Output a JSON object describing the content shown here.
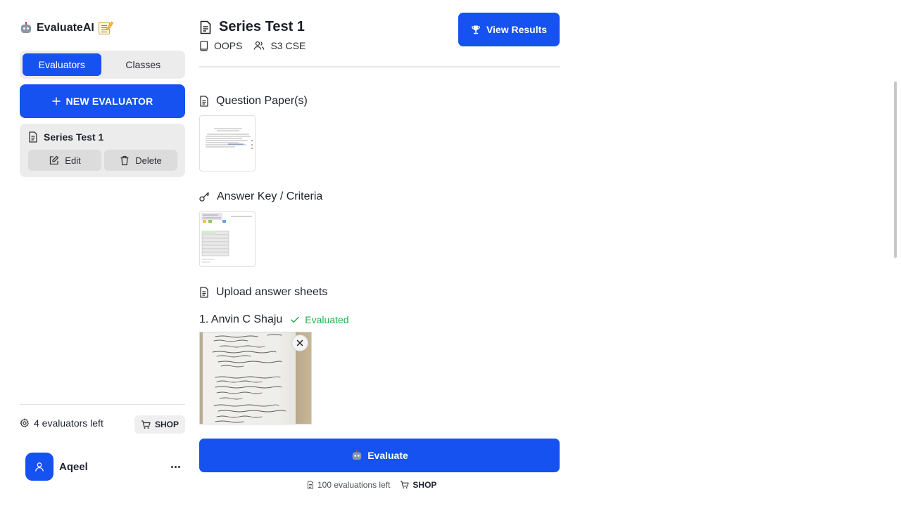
{
  "app": {
    "name": "EvaluateAI",
    "icons": [
      "robot-emoji",
      "memo-emoji"
    ]
  },
  "sidebar": {
    "tabs": [
      {
        "label": "Evaluators",
        "active": true
      },
      {
        "label": "Classes",
        "active": false
      }
    ],
    "new_button": "NEW EVALUATOR",
    "evaluators": [
      {
        "title": "Series Test 1",
        "edit_label": "Edit",
        "delete_label": "Delete"
      }
    ],
    "evaluators_left": "4 evaluators left",
    "shop_label": "SHOP",
    "user": {
      "name": "Aqeel"
    }
  },
  "main": {
    "title": "Series Test 1",
    "subject": "OOPS",
    "class": "S3 CSE",
    "view_results_label": "View Results",
    "sections": {
      "question_paper": "Question Paper(s)",
      "answer_key": "Answer Key / Criteria",
      "upload": "Upload answer sheets"
    },
    "students": [
      {
        "label": "1. Anvin C Shaju",
        "status": "Evaluated"
      }
    ],
    "evaluate_label": "Evaluate",
    "evaluations_left": "100 evaluations left",
    "shop_label": "SHOP"
  },
  "colors": {
    "accent": "#1652f0",
    "success": "#22b14c",
    "muted_bg": "#ececec"
  }
}
